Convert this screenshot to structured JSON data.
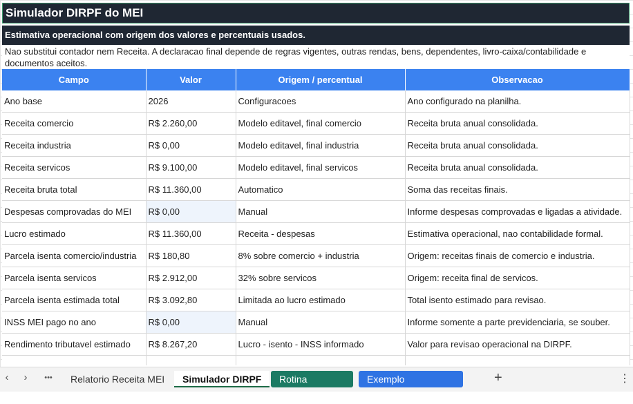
{
  "sheet": {
    "title": "Simulador DIRPF do MEI",
    "subtitle": "Estimativa operacional com origem dos valores e percentuais usados.",
    "note": "Nao substitui contador nem Receita. A declaracao final depende de regras vigentes, outras rendas, bens, dependentes, livro-caixa/contabilidade e documentos aceitos.",
    "columns": [
      "Campo",
      "Valor",
      "Origem / percentual",
      "Observacao"
    ],
    "rows": [
      {
        "campo": "Ano base",
        "valor": "2026",
        "origem": "Configuracoes",
        "obs": "Ano configurado na planilha."
      },
      {
        "campo": "Receita comercio",
        "valor": "R$ 2.260,00",
        "origem": "Modelo editavel, final comercio",
        "obs": "Receita bruta anual consolidada."
      },
      {
        "campo": "Receita industria",
        "valor": "R$ 0,00",
        "origem": "Modelo editavel, final industria",
        "obs": "Receita bruta anual consolidada."
      },
      {
        "campo": "Receita servicos",
        "valor": "R$ 9.100,00",
        "origem": "Modelo editavel, final servicos",
        "obs": "Receita bruta anual consolidada."
      },
      {
        "campo": "Receita bruta total",
        "valor": "R$ 11.360,00",
        "origem": "Automatico",
        "obs": "Soma das receitas finais."
      },
      {
        "campo": "Despesas comprovadas do MEI",
        "valor": "R$ 0,00",
        "origem": "Manual",
        "obs": "Informe despesas comprovadas e ligadas a atividade."
      },
      {
        "campo": "Lucro estimado",
        "valor": "R$ 11.360,00",
        "origem": "Receita - despesas",
        "obs": "Estimativa operacional, nao contabilidade formal."
      },
      {
        "campo": "Parcela isenta comercio/industria",
        "valor": "R$ 180,80",
        "origem": "8% sobre comercio + industria",
        "obs": "Origem: receitas finais de comercio e industria."
      },
      {
        "campo": "Parcela isenta servicos",
        "valor": "R$ 2.912,00",
        "origem": "32% sobre servicos",
        "obs": "Origem: receita final de servicos."
      },
      {
        "campo": "Parcela isenta estimada total",
        "valor": "R$ 3.092,80",
        "origem": "Limitada ao lucro estimado",
        "obs": "Total isento estimado para revisao."
      },
      {
        "campo": "INSS MEI pago no ano",
        "valor": "R$ 0,00",
        "origem": "Manual",
        "obs": "Informe somente a parte previdenciaria, se souber."
      },
      {
        "campo": "Rendimento tributavel estimado",
        "valor": "R$ 8.267,20",
        "origem": "Lucro - isento - INSS informado",
        "obs": "Valor para revisao operacional na DIRPF."
      }
    ]
  },
  "tabs": {
    "prev_icon": "‹",
    "next_icon": "›",
    "more_icon": "•••",
    "items": [
      {
        "label": "Relatorio Receita MEI"
      },
      {
        "label": "Simulador DIRPF"
      },
      {
        "label": "Rotina Semanal"
      },
      {
        "label": "Exemplo Preenchido"
      }
    ],
    "add_icon": "+",
    "menu_icon": "⋮"
  },
  "colors": {
    "header_dark": "#1f2733",
    "column_header_blue": "#3b82f0",
    "tab_green": "#1b7a63",
    "tab_blue": "#2f73e3",
    "input_cell": "#eef4fc"
  }
}
